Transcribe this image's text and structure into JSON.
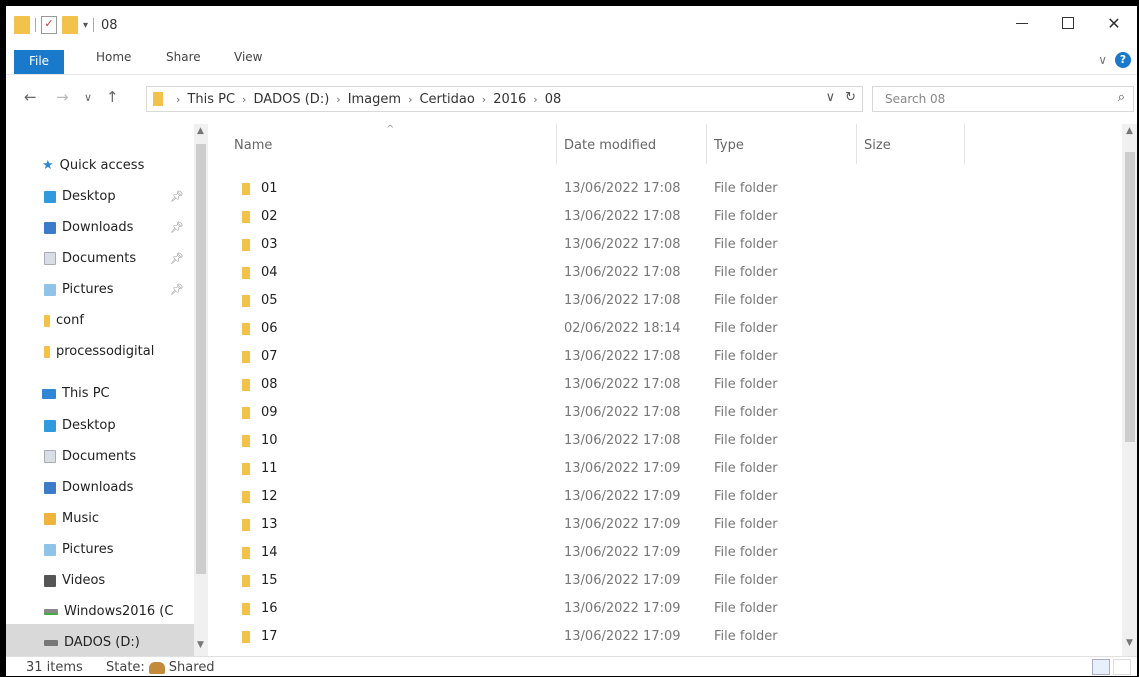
{
  "window": {
    "title": "08"
  },
  "ribbon": {
    "tabs": [
      "File",
      "Home",
      "Share",
      "View"
    ]
  },
  "address": {
    "breadcrumbs": [
      "This PC",
      "DADOS (D:)",
      "Imagem",
      "Certidao",
      "2016",
      "08"
    ],
    "search_placeholder": "Search 08"
  },
  "nav": {
    "quick_access": "Quick access",
    "quick_items": [
      {
        "label": "Desktop",
        "icon": "desktop-folder-icon",
        "pinned": true
      },
      {
        "label": "Downloads",
        "icon": "downloads-folder-icon",
        "pinned": true
      },
      {
        "label": "Documents",
        "icon": "documents-folder-icon",
        "pinned": true
      },
      {
        "label": "Pictures",
        "icon": "pictures-folder-icon",
        "pinned": true
      },
      {
        "label": "conf",
        "icon": "folder-icon",
        "pinned": false
      },
      {
        "label": "processodigital",
        "icon": "folder-icon",
        "pinned": false
      }
    ],
    "this_pc": "This PC",
    "pc_items": [
      {
        "label": "Desktop",
        "icon": "desktop-folder-icon"
      },
      {
        "label": "Documents",
        "icon": "documents-folder-icon"
      },
      {
        "label": "Downloads",
        "icon": "downloads-folder-icon"
      },
      {
        "label": "Music",
        "icon": "music-folder-icon"
      },
      {
        "label": "Pictures",
        "icon": "pictures-folder-icon"
      },
      {
        "label": "Videos",
        "icon": "videos-folder-icon"
      },
      {
        "label": "Windows2016 (C",
        "icon": "system-drive-icon"
      },
      {
        "label": "DADOS (D:)",
        "icon": "drive-icon"
      }
    ]
  },
  "columns": {
    "name": "Name",
    "date": "Date modified",
    "type": "Type",
    "size": "Size"
  },
  "files": [
    {
      "name": "01",
      "date": "13/06/2022 17:08",
      "type": "File folder"
    },
    {
      "name": "02",
      "date": "13/06/2022 17:08",
      "type": "File folder"
    },
    {
      "name": "03",
      "date": "13/06/2022 17:08",
      "type": "File folder"
    },
    {
      "name": "04",
      "date": "13/06/2022 17:08",
      "type": "File folder"
    },
    {
      "name": "05",
      "date": "13/06/2022 17:08",
      "type": "File folder"
    },
    {
      "name": "06",
      "date": "02/06/2022 18:14",
      "type": "File folder"
    },
    {
      "name": "07",
      "date": "13/06/2022 17:08",
      "type": "File folder"
    },
    {
      "name": "08",
      "date": "13/06/2022 17:08",
      "type": "File folder"
    },
    {
      "name": "09",
      "date": "13/06/2022 17:08",
      "type": "File folder"
    },
    {
      "name": "10",
      "date": "13/06/2022 17:08",
      "type": "File folder"
    },
    {
      "name": "11",
      "date": "13/06/2022 17:09",
      "type": "File folder"
    },
    {
      "name": "12",
      "date": "13/06/2022 17:09",
      "type": "File folder"
    },
    {
      "name": "13",
      "date": "13/06/2022 17:09",
      "type": "File folder"
    },
    {
      "name": "14",
      "date": "13/06/2022 17:09",
      "type": "File folder"
    },
    {
      "name": "15",
      "date": "13/06/2022 17:09",
      "type": "File folder"
    },
    {
      "name": "16",
      "date": "13/06/2022 17:09",
      "type": "File folder"
    },
    {
      "name": "17",
      "date": "13/06/2022 17:09",
      "type": "File folder"
    }
  ],
  "status": {
    "count": "31 items",
    "state_label": "State:",
    "state_value": "Shared"
  },
  "colors": {
    "accent": "#1979ca",
    "folder": "#f3c24a"
  }
}
